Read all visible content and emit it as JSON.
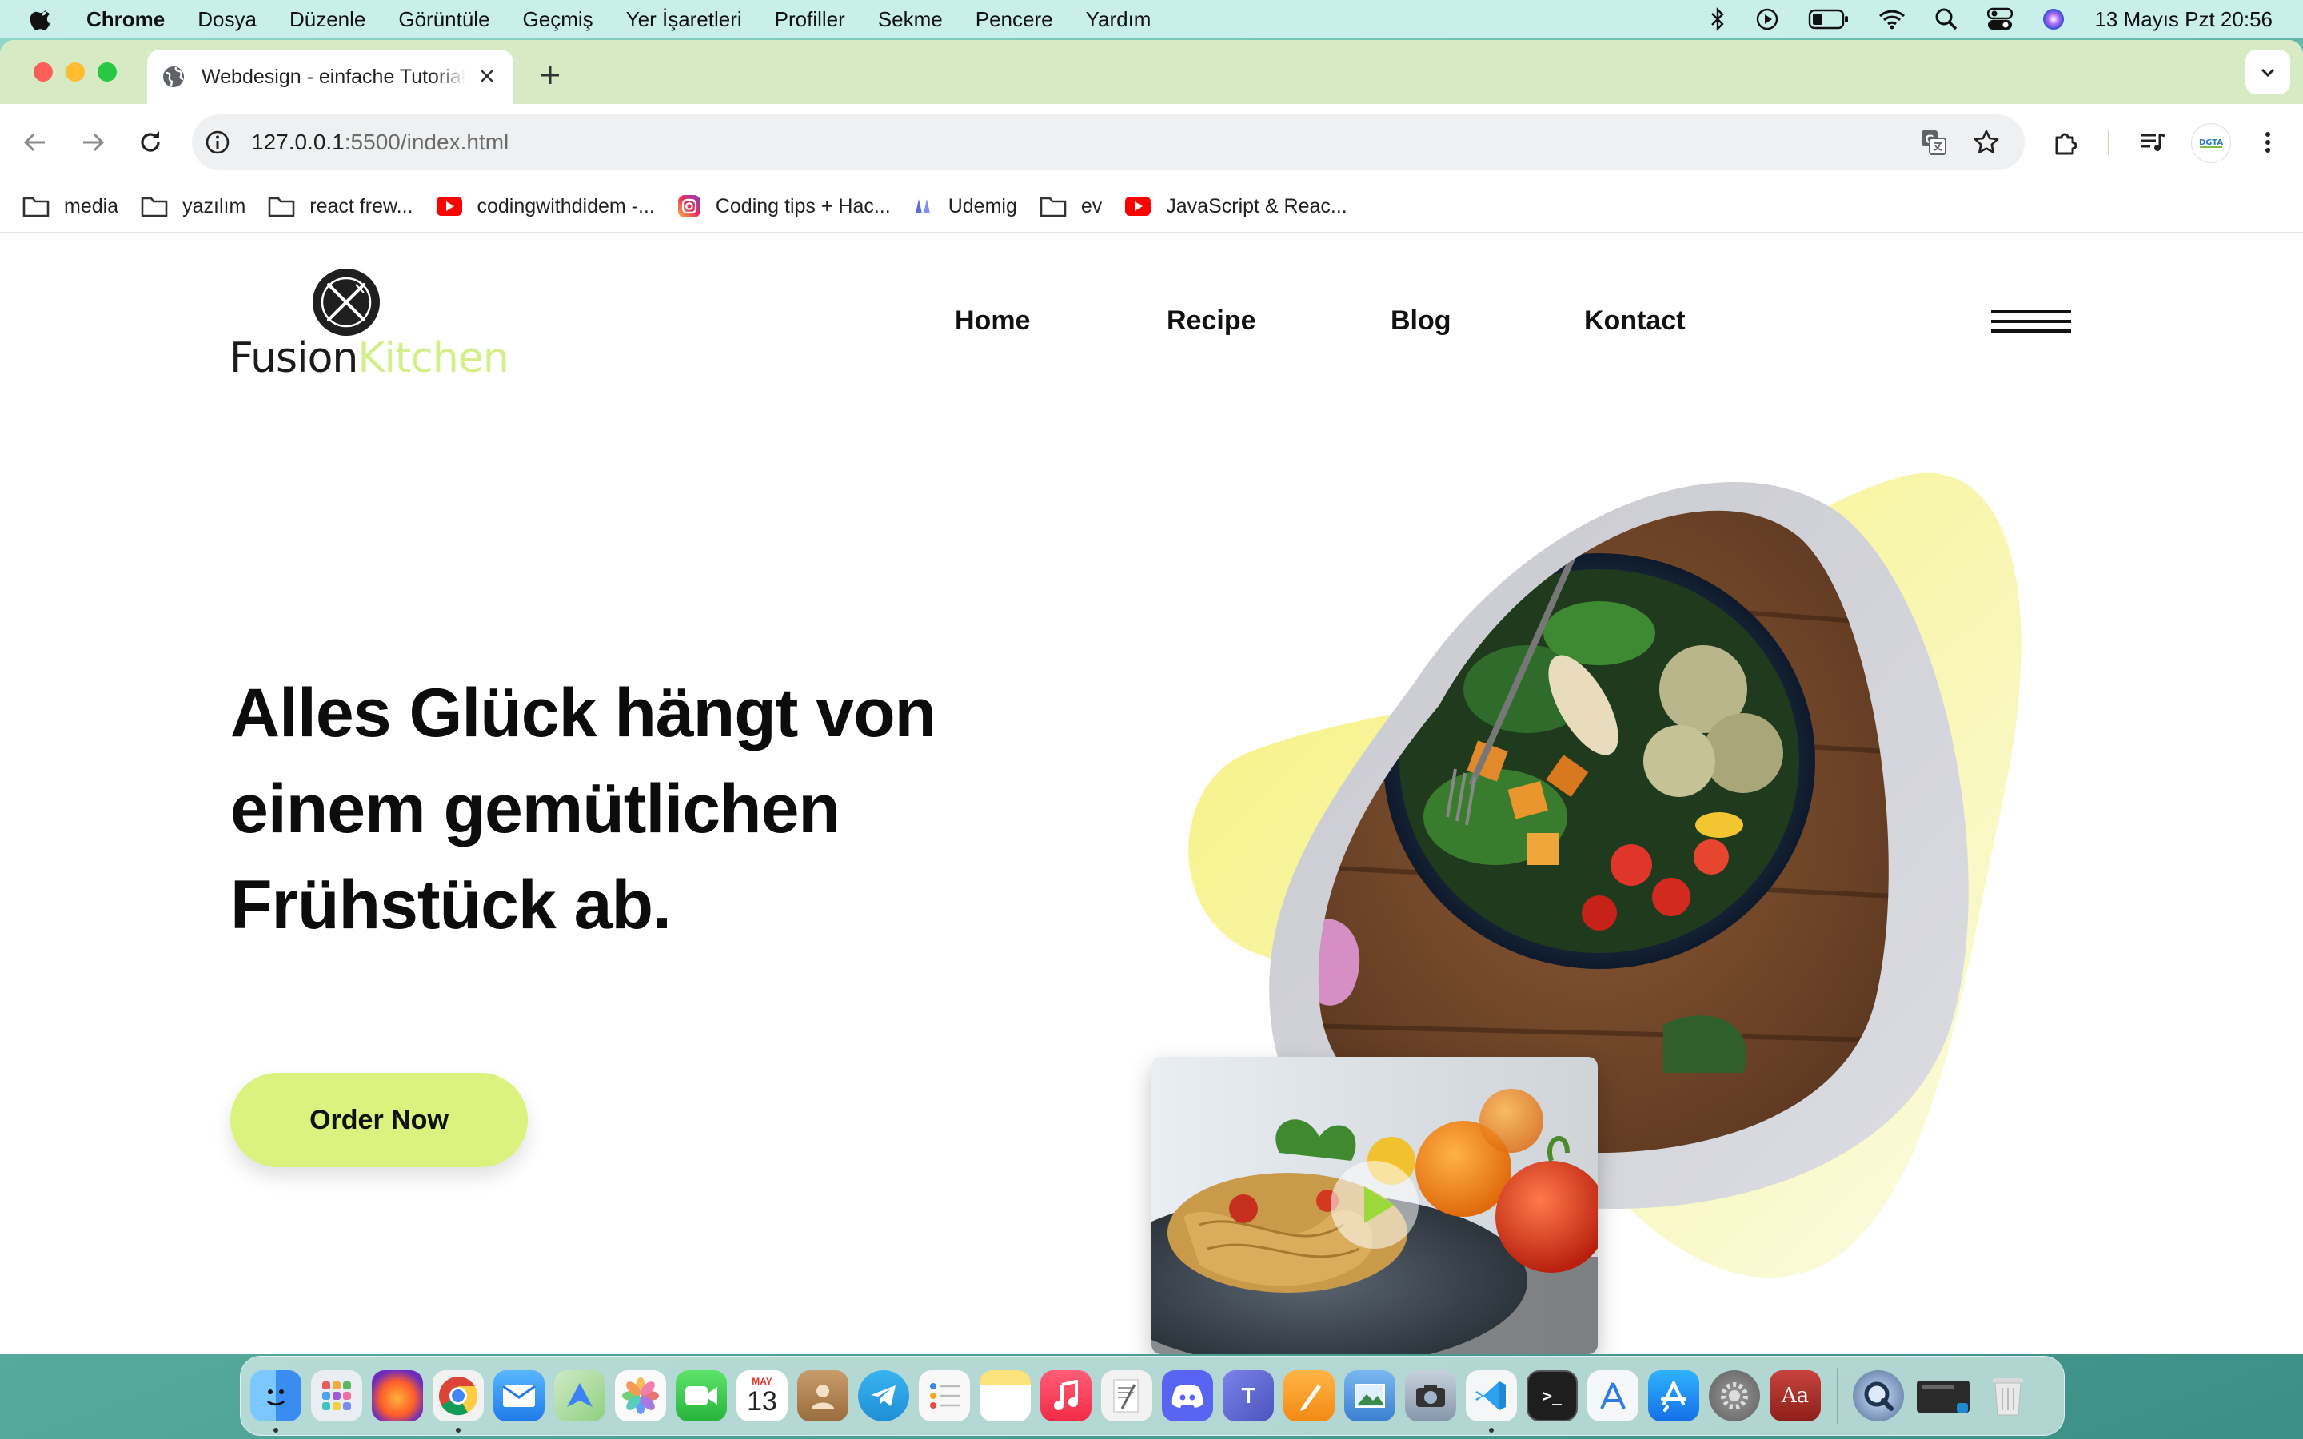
{
  "menubar": {
    "items": [
      "Chrome",
      "Dosya",
      "Düzenle",
      "Görüntüle",
      "Geçmiş",
      "Yer İşaretleri",
      "Profiller",
      "Sekme",
      "Pencere",
      "Yardım"
    ],
    "clock": "13 Mayıs Pzt  20:56"
  },
  "browser": {
    "tab_title": "Webdesign - einfache Tutorials",
    "url_host": "127.0.0.1",
    "url_rest": ":5500/index.html",
    "bookmarks": [
      {
        "label": "media",
        "icon": "folder-icon"
      },
      {
        "label": "yazılım",
        "icon": "folder-icon"
      },
      {
        "label": "react frew...",
        "icon": "folder-icon"
      },
      {
        "label": "codingwithdidem -...",
        "icon": "youtube-icon"
      },
      {
        "label": "Coding tips + Hac...",
        "icon": "instagram-icon"
      },
      {
        "label": "Udemig",
        "icon": "udemig-icon"
      },
      {
        "label": "ev",
        "icon": "folder-icon"
      },
      {
        "label": "JavaScript & Reac...",
        "icon": "youtube-icon"
      }
    ]
  },
  "site": {
    "logo_word_1": "Fusion",
    "logo_word_2": "Kitchen",
    "nav": [
      "Home",
      "Recipe",
      "Blog",
      "Kontact"
    ],
    "hero_title": "Alles Glück hängt von einem gemütlichen Frühstück ab.",
    "cta_label": "Order Now"
  },
  "dock": {
    "apps": [
      {
        "name": "finder-icon",
        "color": "#3fa0f5"
      },
      {
        "name": "launchpad-icon",
        "color": "#e9eef5"
      },
      {
        "name": "firefox-icon",
        "color": "#5b2aa8"
      },
      {
        "name": "chrome-icon",
        "color": "#f2f2f2"
      },
      {
        "name": "mail-icon",
        "color": "#3b8ff0"
      },
      {
        "name": "maps-icon",
        "color": "#5fbf6a"
      },
      {
        "name": "photos-icon",
        "color": "#f5f5f5"
      },
      {
        "name": "facetime-icon",
        "color": "#36c94c"
      },
      {
        "name": "calendar-icon",
        "color": "#ffffff"
      },
      {
        "name": "contacts-icon",
        "color": "#b98b5a"
      },
      {
        "name": "telegram-icon",
        "color": "#2aa3e0"
      },
      {
        "name": "reminders-icon",
        "color": "#f7f7f7"
      },
      {
        "name": "notes-icon",
        "color": "#f8d44a"
      },
      {
        "name": "music-icon",
        "color": "#f53b57"
      },
      {
        "name": "textedit-icon",
        "color": "#efefef"
      },
      {
        "name": "discord-icon",
        "color": "#5865f2"
      },
      {
        "name": "teams-icon",
        "color": "#5a5fc7"
      },
      {
        "name": "pages-icon",
        "color": "#f59b22"
      },
      {
        "name": "preview-icon",
        "color": "#4d8ed8"
      },
      {
        "name": "screenshot-icon",
        "color": "#8a9bb2"
      },
      {
        "name": "vscode-icon",
        "color": "#1f8ad2"
      },
      {
        "name": "terminal-icon",
        "color": "#222222"
      },
      {
        "name": "instruments-icon",
        "color": "#3d84e8"
      },
      {
        "name": "appstore-icon",
        "color": "#1f8cf5"
      },
      {
        "name": "settings-icon",
        "color": "#8c8c8c"
      },
      {
        "name": "dictionary-icon",
        "color": "#b3312b"
      }
    ],
    "calendar_month": "MAY",
    "calendar_day": "13",
    "dictionary_label": "Aa"
  }
}
